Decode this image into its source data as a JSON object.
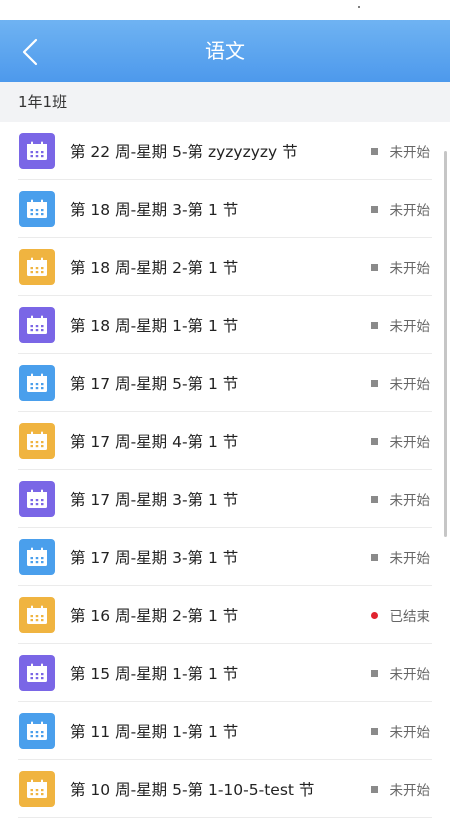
{
  "nav": {
    "title": "语文"
  },
  "section": {
    "label": "1年1班"
  },
  "colors": {
    "purple": "#7a66e6",
    "blue": "#4a9fec",
    "orange": "#f0b440",
    "nav_bar": "#5aa3ee",
    "ended_dot": "#e0242f"
  },
  "items": [
    {
      "title": "第 22 周-星期 5-第 zyzyzyzy 节",
      "status": "未开始",
      "icon_color": "purple",
      "ended": false
    },
    {
      "title": "第 18 周-星期 3-第 1 节",
      "status": "未开始",
      "icon_color": "blue",
      "ended": false
    },
    {
      "title": "第 18 周-星期 2-第 1 节",
      "status": "未开始",
      "icon_color": "orange",
      "ended": false
    },
    {
      "title": "第 18 周-星期 1-第 1 节",
      "status": "未开始",
      "icon_color": "purple",
      "ended": false
    },
    {
      "title": "第 17 周-星期 5-第 1 节",
      "status": "未开始",
      "icon_color": "blue",
      "ended": false
    },
    {
      "title": "第 17 周-星期 4-第 1 节",
      "status": "未开始",
      "icon_color": "orange",
      "ended": false
    },
    {
      "title": "第 17 周-星期 3-第 1 节",
      "status": "未开始",
      "icon_color": "purple",
      "ended": false
    },
    {
      "title": "第 17 周-星期 3-第 1 节",
      "status": "未开始",
      "icon_color": "blue",
      "ended": false
    },
    {
      "title": "第 16 周-星期 2-第 1 节",
      "status": "已结束",
      "icon_color": "orange",
      "ended": true
    },
    {
      "title": "第 15 周-星期 1-第 1 节",
      "status": "未开始",
      "icon_color": "purple",
      "ended": false
    },
    {
      "title": "第 11 周-星期 1-第 1 节",
      "status": "未开始",
      "icon_color": "blue",
      "ended": false
    },
    {
      "title": "第 10 周-星期 5-第 1-10-5-test 节",
      "status": "未开始",
      "icon_color": "orange",
      "ended": false
    }
  ]
}
